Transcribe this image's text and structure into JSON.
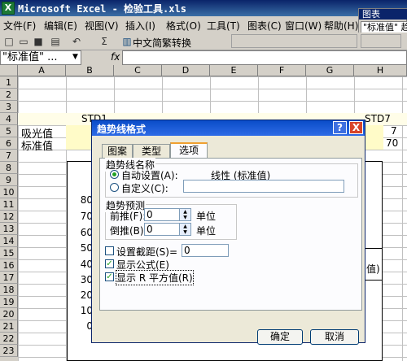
{
  "window": {
    "title": "Microsoft Excel - 检验工具.xls",
    "app_icon": "excel-icon"
  },
  "chart_toolbar": {
    "title": "图表",
    "selected_item": "\"标准值\" 趋"
  },
  "menu": [
    "文件(F)",
    "编辑(E)",
    "视图(V)",
    "插入(I)",
    "格式(O)",
    "工具(T)",
    "图表(C)",
    "窗口(W)",
    "帮助(H)"
  ],
  "toolbar": {
    "icons": [
      "new-icon",
      "open-icon",
      "save-icon",
      "print-icon",
      "undo-icon",
      "sum-icon",
      "chart-wizard-icon",
      "help-icon"
    ],
    "sum_symbol": "Σ",
    "convert_label": "中文简繁转换"
  },
  "formula_bar": {
    "name_box": "\"标准值\" ...",
    "fx": "fx",
    "value": ""
  },
  "grid": {
    "columns": [
      "A",
      "B",
      "C",
      "D",
      "E",
      "F",
      "G",
      "H"
    ],
    "rows": [
      "1",
      "2",
      "3",
      "4",
      "5",
      "6",
      "7",
      "8",
      "9",
      "10",
      "11",
      "12",
      "13",
      "14",
      "15",
      "16",
      "17",
      "18",
      "19",
      "20",
      "21",
      "22",
      "23"
    ],
    "b4": "STD1",
    "h4": "STD7",
    "a5": "吸光值",
    "a6": "标准值",
    "h5": "7",
    "h6": "70"
  },
  "chart": {
    "y_ticks": [
      "80",
      "70",
      "60",
      "50",
      "40",
      "30",
      "20",
      "10",
      "0"
    ],
    "legend_fragment": "值)"
  },
  "dialog": {
    "title": "趋势线格式",
    "help": "?",
    "close": "X",
    "tabs": [
      "图案",
      "类型",
      "选项"
    ],
    "active_tab": "选项",
    "name_group": "趋势线名称",
    "auto_label": "自动设置(A):",
    "auto_value": "线性 (标准值)",
    "custom_label": "自定义(C):",
    "custom_value": "",
    "forecast_group": "趋势预测",
    "forward_label": "前推(F):",
    "forward_value": "0",
    "forward_unit": "单位",
    "backward_label": "倒推(B):",
    "backward_value": "0",
    "backward_unit": "单位",
    "intercept_label": "设置截距(S)=",
    "intercept_value": "0",
    "intercept_checked": false,
    "show_equation_label": "显示公式(E)",
    "show_equation_checked": true,
    "show_r2_label": "显示 R 平方值(R)",
    "show_r2_checked": true,
    "ok": "确定",
    "cancel": "取消"
  }
}
